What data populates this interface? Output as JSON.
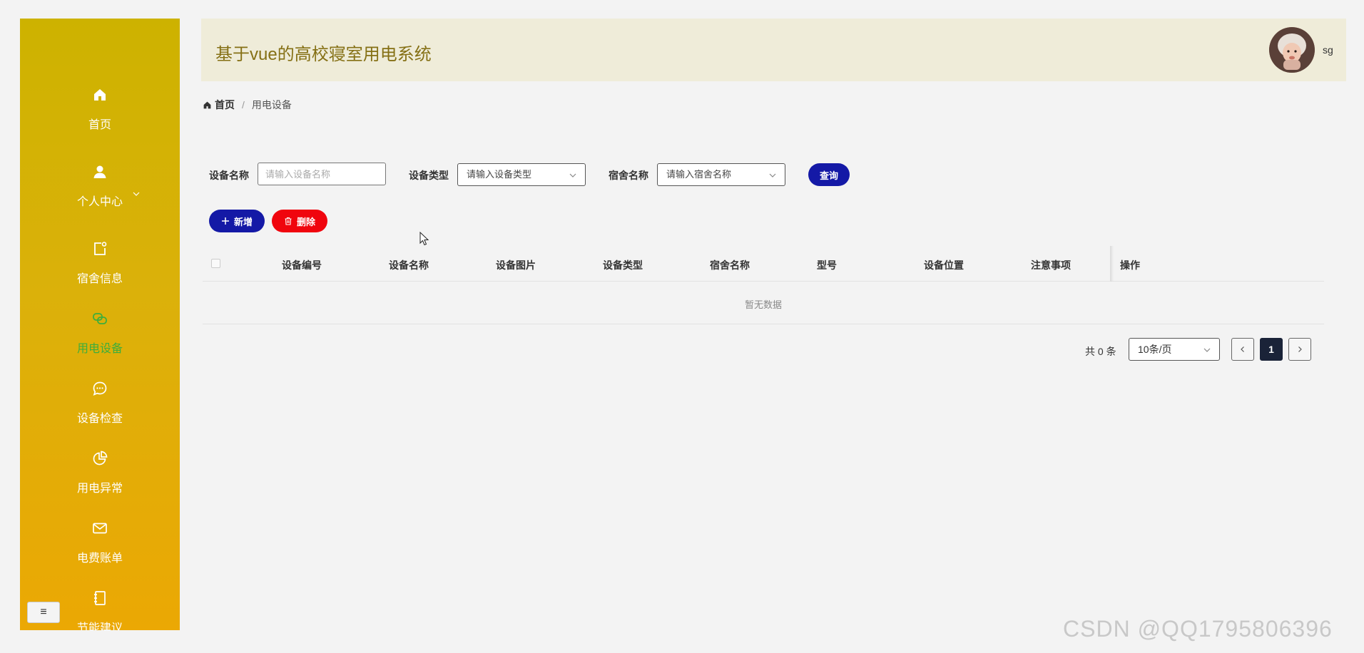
{
  "sidebar": {
    "items": [
      {
        "label": "首页",
        "icon": "home-icon"
      },
      {
        "label": "个人中心",
        "icon": "user-icon"
      },
      {
        "label": "宿舍信息",
        "icon": "doc-icon"
      },
      {
        "label": "用电设备",
        "icon": "link-icon"
      },
      {
        "label": "设备检查",
        "icon": "chat-icon"
      },
      {
        "label": "用电异常",
        "icon": "pie-icon"
      },
      {
        "label": "电费账单",
        "icon": "mail-icon"
      },
      {
        "label": "节能建议",
        "icon": "notebook-icon"
      }
    ],
    "active_index": 3,
    "collapse_label": "≡"
  },
  "header": {
    "title": "基于vue的高校寝室用电系统",
    "username": "sg"
  },
  "breadcrumb": {
    "home": "首页",
    "separator": "/",
    "current": "用电设备"
  },
  "search": {
    "device_name_label": "设备名称",
    "device_name_placeholder": "请输入设备名称",
    "device_type_label": "设备类型",
    "device_type_placeholder": "请输入设备类型",
    "dorm_name_label": "宿舍名称",
    "dorm_name_placeholder": "请输入宿舍名称",
    "query_button": "查询"
  },
  "actions": {
    "add": "新增",
    "delete": "删除"
  },
  "table": {
    "columns": [
      "设备编号",
      "设备名称",
      "设备图片",
      "设备类型",
      "宿舍名称",
      "型号",
      "设备位置",
      "注意事项",
      "操作"
    ],
    "empty_text": "暂无数据"
  },
  "pagination": {
    "total_text": "共 0 条",
    "page_size": "10条/页",
    "current_page": "1"
  },
  "watermark": "CSDN @QQ1795806396",
  "colors": {
    "sidebar_top": "#cdb200",
    "sidebar_bottom": "#eba804",
    "header_bg": "#efecd9",
    "title": "#857015",
    "active_nav": "#3cae3c",
    "primary_button": "#1419a6",
    "danger_button": "#f0050e"
  }
}
